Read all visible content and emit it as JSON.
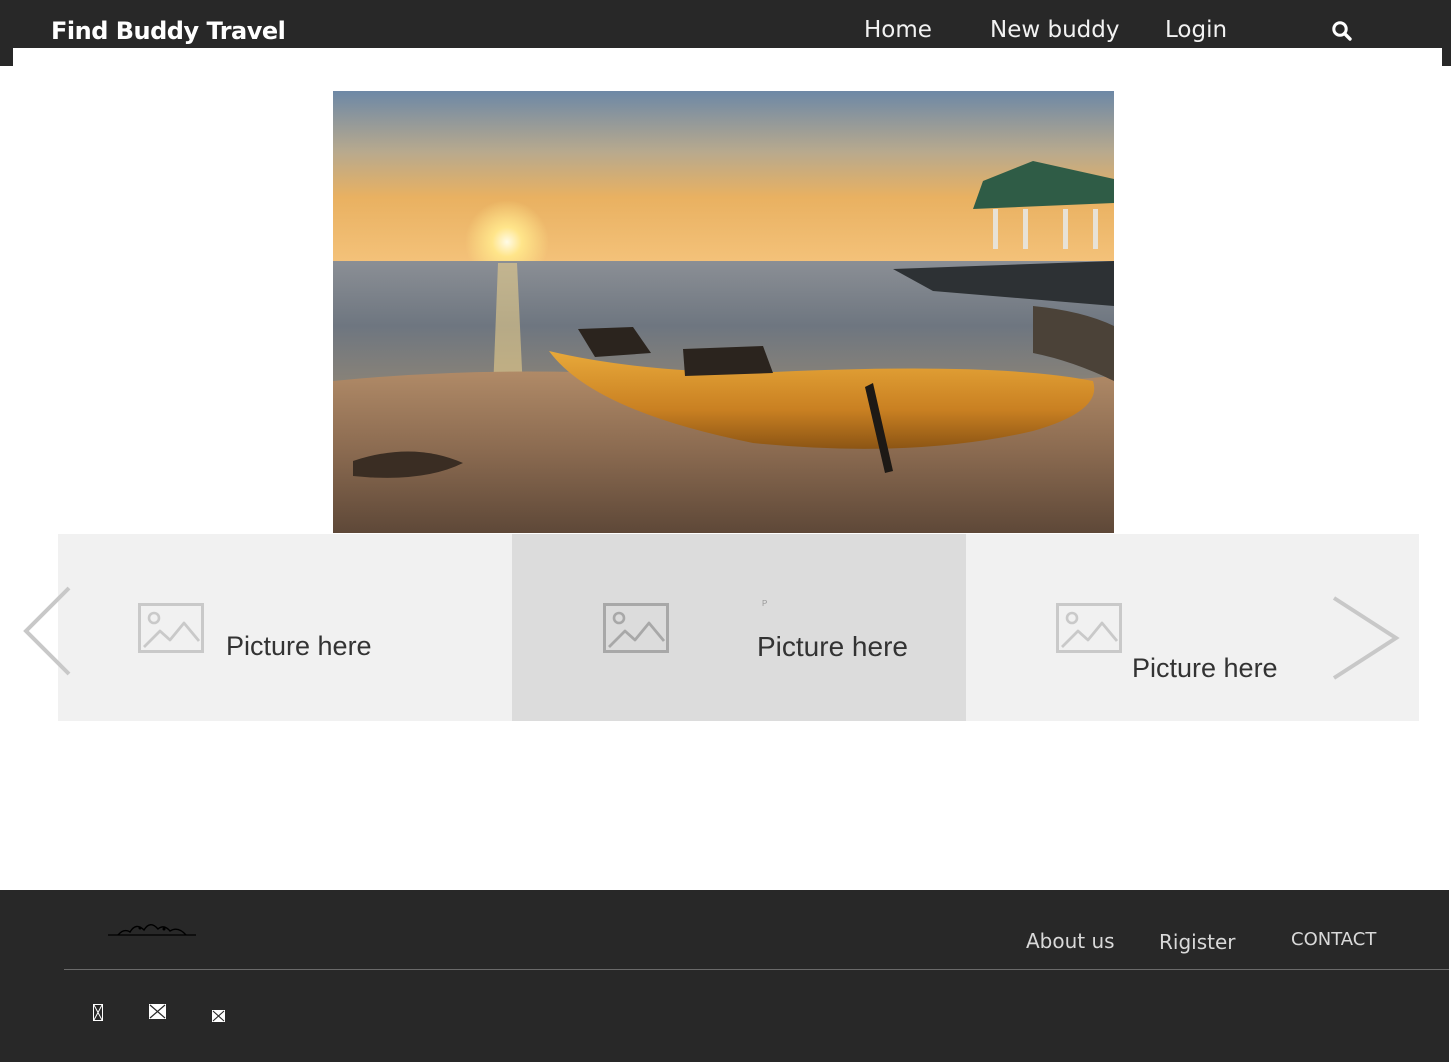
{
  "header": {
    "brand": "Find Buddy Travel",
    "nav": {
      "home": "Home",
      "new_buddy": "New buddy",
      "login": "Login"
    },
    "search_icon": "search-icon"
  },
  "hero": {
    "image": "beach-sunset-kayak-photo"
  },
  "carousel": {
    "slides": [
      {
        "label": "Picture here",
        "icon": "image-placeholder-icon"
      },
      {
        "label": "Picture here",
        "icon": "image-placeholder-icon",
        "mark": "P"
      },
      {
        "label": "Picture here",
        "icon": "image-placeholder-icon"
      }
    ],
    "prev_icon": "chevron-left-icon",
    "next_icon": "chevron-right-icon"
  },
  "footer": {
    "logo": "travel-logo",
    "links": {
      "about": "About us",
      "register": "Rigister",
      "contact": "CONTACT"
    },
    "social_icons": [
      "social-icon",
      "mail-icon",
      "mail-icon"
    ]
  },
  "colors": {
    "dark": "#282828",
    "slide_light": "#f1f1f1",
    "slide_active": "#dcdcdc",
    "text_light": "#f2f2f2"
  }
}
